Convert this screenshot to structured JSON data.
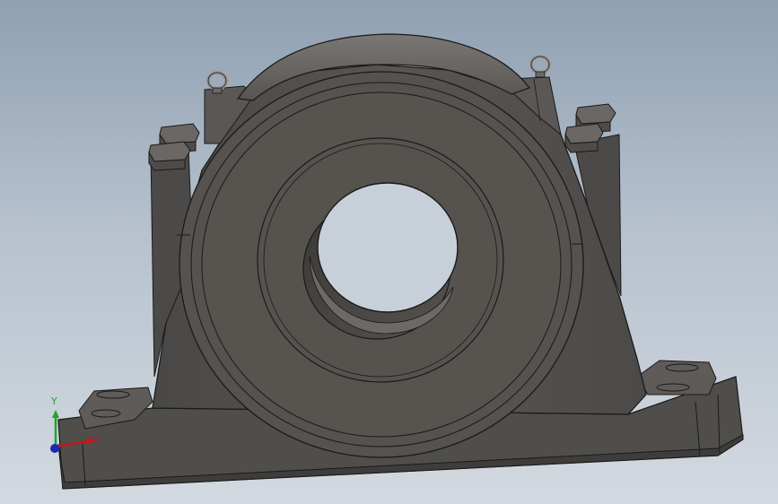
{
  "viewport": {
    "background_top": "#8fa0b2",
    "background_bottom": "#d3d9e0"
  },
  "model": {
    "name": "plummer-block-housing",
    "body_color": "#555250"
  },
  "triad": {
    "x_label": "X",
    "y_label": "Y",
    "x_color": "#c8141e",
    "y_color": "#1fa52a",
    "z_color": "#1c28b4"
  }
}
